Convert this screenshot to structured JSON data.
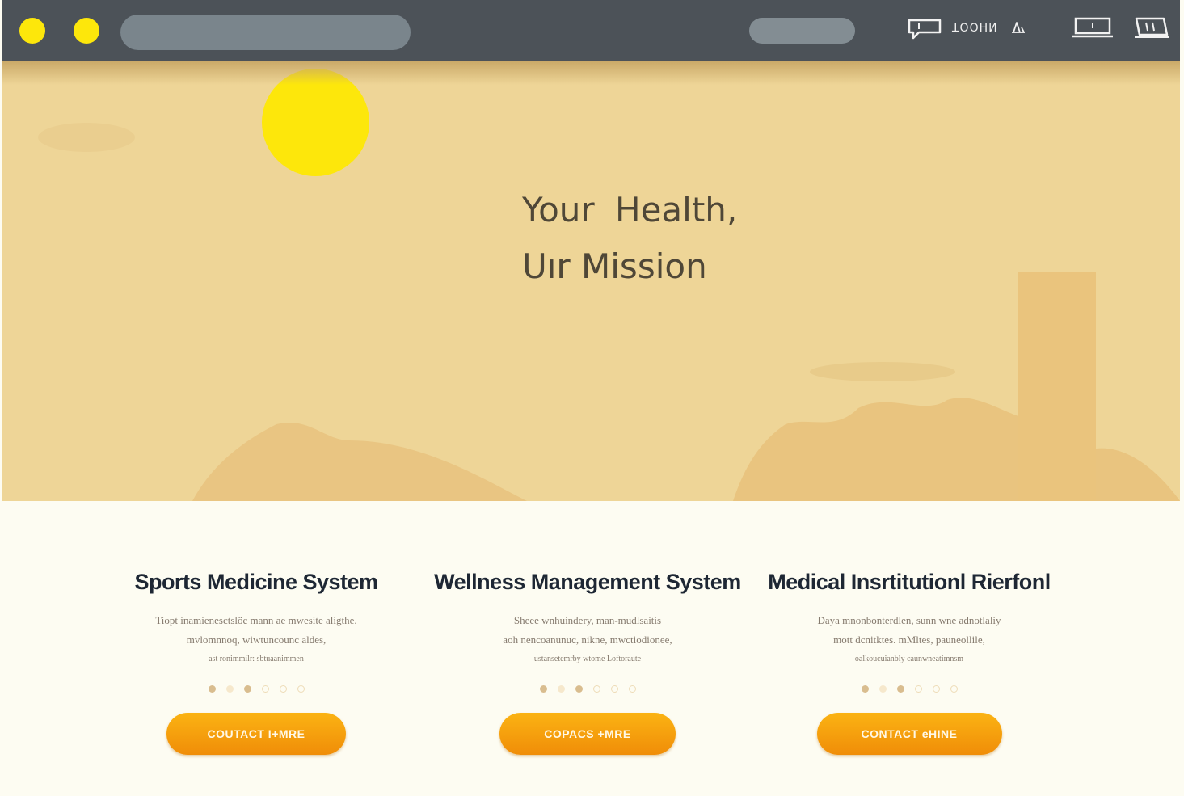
{
  "browser": {
    "nav_label": "ꓕOOHИ",
    "icons": [
      "chat-icon",
      "bell-icon",
      "monitor-icon",
      "book-icon"
    ]
  },
  "hero": {
    "title_line1": "Your Health,",
    "title_line2": "Uır Mission"
  },
  "cards": [
    {
      "title": "Sports Medicine System",
      "text_line1": "Tiopt inamienesctslöc  mann ae mwesite aligthe.",
      "text_line2": "mvlomnnoq, wiwtuncounc aldes,",
      "text_line3": "ast ronimmilr: sbtuaanimmen",
      "button": "COUTACT I+MRE"
    },
    {
      "title": "Wellness Management System",
      "text_line1": "Sheee wnhuindery, man-mudlsaitis",
      "text_line2": "aoh nencoanunuc, nikne, mwctiodionee,",
      "text_line3": "ustansetemrby wtome Loftoraute",
      "button": "COPACS +MRE"
    },
    {
      "title": "Medical Insrtitutionl Rierfonl",
      "text_line1": "Daya mnonbonterdlen, sunn wne adnotlaliy",
      "text_line2": "mott dcnitktes. mMltes, pauneollile,",
      "text_line3": "oalkoucuianbly caunwneatimnsm",
      "button": "CONTACT eHINE"
    }
  ],
  "colors": {
    "topbar": "#4c5258",
    "hero_bg": "#eed597",
    "sun": "#fde70b",
    "cta": "#f7a10e",
    "page_bg": "#fdfcf2"
  }
}
